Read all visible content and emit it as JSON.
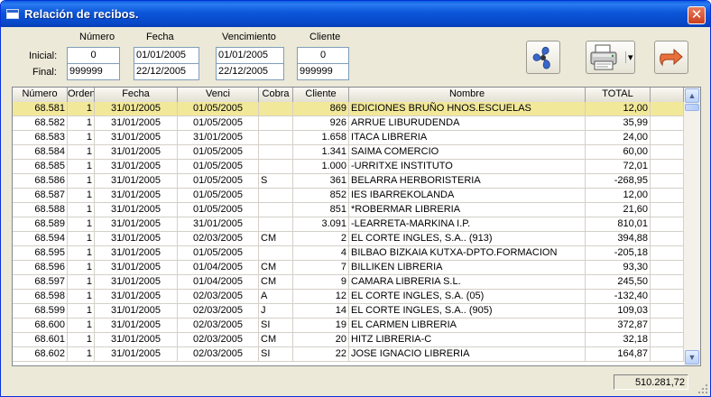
{
  "window": {
    "title": "Relación de recibos.",
    "close_glyph": "✕"
  },
  "filters": {
    "headers": {
      "numero": "Número",
      "fecha": "Fecha",
      "vencimiento": "Vencimiento",
      "cliente": "Cliente"
    },
    "inicial_label": "Inicial:",
    "final_label": "Final:",
    "numero_inicial": "0",
    "numero_final": "999999",
    "fecha_inicial": "01/01/2005",
    "fecha_final": "22/12/2005",
    "venc_inicial": "01/01/2005",
    "venc_final": "22/12/2005",
    "cliente_inicial": "0",
    "cliente_final": "999999"
  },
  "toolbar": {
    "fan_icon": "fan-icon",
    "printer_icon": "printer-icon",
    "exit_icon": "exit-arrow-icon",
    "dropdown_glyph": "▾"
  },
  "grid": {
    "columns": [
      "Número",
      "Orden",
      "Fecha",
      "Venci",
      "Cobra",
      "Cliente",
      "Nombre",
      "TOTAL"
    ],
    "rows": [
      {
        "numero": "68.581",
        "orden": "1",
        "fecha": "31/01/2005",
        "venci": "01/05/2005",
        "cobra": "",
        "cliente": "869",
        "nombre": "EDICIONES BRUÑO  HNOS.ESCUELAS",
        "total": "12,00"
      },
      {
        "numero": "68.582",
        "orden": "1",
        "fecha": "31/01/2005",
        "venci": "01/05/2005",
        "cobra": "",
        "cliente": "926",
        "nombre": "ARRUE LIBURUDENDA",
        "total": "35,99"
      },
      {
        "numero": "68.583",
        "orden": "1",
        "fecha": "31/01/2005",
        "venci": "31/01/2005",
        "cobra": "",
        "cliente": "1.658",
        "nombre": "ITACA LIBRERIA",
        "total": "24,00"
      },
      {
        "numero": "68.584",
        "orden": "1",
        "fecha": "31/01/2005",
        "venci": "01/05/2005",
        "cobra": "",
        "cliente": "1.341",
        "nombre": "SAIMA COMERCIO",
        "total": "60,00"
      },
      {
        "numero": "68.585",
        "orden": "1",
        "fecha": "31/01/2005",
        "venci": "01/05/2005",
        "cobra": "",
        "cliente": "1.000",
        "nombre": "-URRITXE INSTITUTO",
        "total": "72,01"
      },
      {
        "numero": "68.586",
        "orden": "1",
        "fecha": "31/01/2005",
        "venci": "01/05/2005",
        "cobra": "S",
        "cliente": "361",
        "nombre": "BELARRA HERBORISTERIA",
        "total": "-268,95"
      },
      {
        "numero": "68.587",
        "orden": "1",
        "fecha": "31/01/2005",
        "venci": "01/05/2005",
        "cobra": "",
        "cliente": "852",
        "nombre": "IES IBARREKOLANDA",
        "total": "12,00"
      },
      {
        "numero": "68.588",
        "orden": "1",
        "fecha": "31/01/2005",
        "venci": "01/05/2005",
        "cobra": "",
        "cliente": "851",
        "nombre": "*ROBERMAR LIBRERIA",
        "total": "21,60"
      },
      {
        "numero": "68.589",
        "orden": "1",
        "fecha": "31/01/2005",
        "venci": "31/01/2005",
        "cobra": "",
        "cliente": "3.091",
        "nombre": "-LEARRETA-MARKINA I.P.",
        "total": "810,01"
      },
      {
        "numero": "68.594",
        "orden": "1",
        "fecha": "31/01/2005",
        "venci": "02/03/2005",
        "cobra": "CM",
        "cliente": "2",
        "nombre": "EL CORTE INGLES, S.A.. (913)",
        "total": "394,88"
      },
      {
        "numero": "68.595",
        "orden": "1",
        "fecha": "31/01/2005",
        "venci": "01/05/2005",
        "cobra": "",
        "cliente": "4",
        "nombre": "BILBAO BIZKAIA KUTXA-DPTO.FORMACION",
        "total": "-205,18"
      },
      {
        "numero": "68.596",
        "orden": "1",
        "fecha": "31/01/2005",
        "venci": "01/04/2005",
        "cobra": "CM",
        "cliente": "7",
        "nombre": "BILLIKEN LIBRERIA",
        "total": "93,30"
      },
      {
        "numero": "68.597",
        "orden": "1",
        "fecha": "31/01/2005",
        "venci": "01/04/2005",
        "cobra": "CM",
        "cliente": "9",
        "nombre": "CAMARA LIBRERIA S.L.",
        "total": "245,50"
      },
      {
        "numero": "68.598",
        "orden": "1",
        "fecha": "31/01/2005",
        "venci": "02/03/2005",
        "cobra": "A",
        "cliente": "12",
        "nombre": "EL CORTE INGLES, S.A. (05)",
        "total": "-132,40"
      },
      {
        "numero": "68.599",
        "orden": "1",
        "fecha": "31/01/2005",
        "venci": "02/03/2005",
        "cobra": "J",
        "cliente": "14",
        "nombre": "EL CORTE INGLES, S.A.. (905)",
        "total": "109,03"
      },
      {
        "numero": "68.600",
        "orden": "1",
        "fecha": "31/01/2005",
        "venci": "02/03/2005",
        "cobra": "SI",
        "cliente": "19",
        "nombre": "EL CARMEN LIBRERIA",
        "total": "372,87"
      },
      {
        "numero": "68.601",
        "orden": "1",
        "fecha": "31/01/2005",
        "venci": "02/03/2005",
        "cobra": "CM",
        "cliente": "20",
        "nombre": "HITZ LIBRERIA-C",
        "total": "32,18"
      },
      {
        "numero": "68.602",
        "orden": "1",
        "fecha": "31/01/2005",
        "venci": "02/03/2005",
        "cobra": "SI",
        "cliente": "22",
        "nombre": "JOSE IGNACIO LIBRERIA",
        "total": "164,87"
      }
    ],
    "scroll_up_glyph": "▲",
    "scroll_down_glyph": "▼"
  },
  "footer": {
    "grand_total": "510.281,72"
  },
  "colors": {
    "titlebar": "#0c56d9",
    "selected_row": "#f2e89a",
    "window_bg": "#ece9d8"
  }
}
